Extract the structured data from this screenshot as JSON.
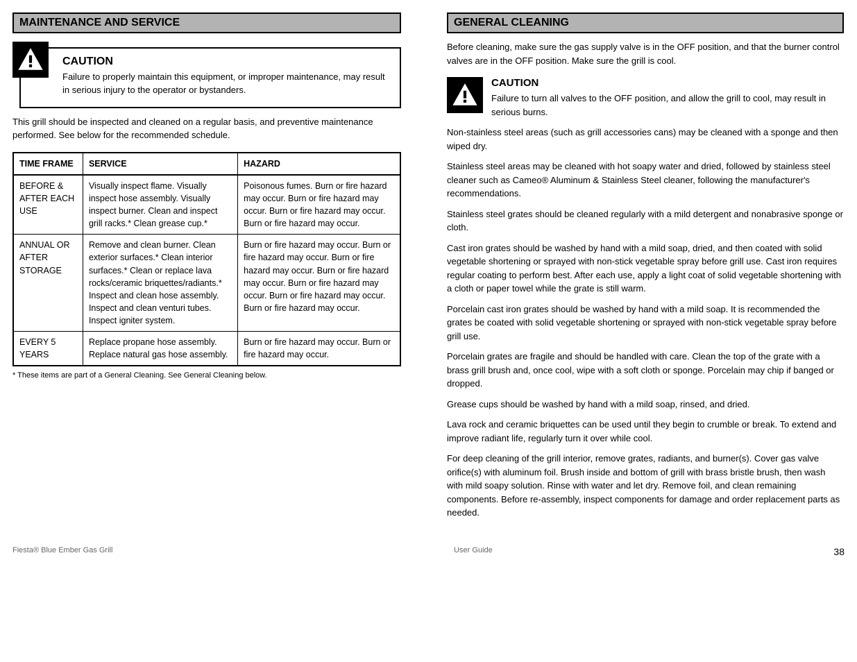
{
  "left": {
    "header": "MAINTENANCE AND SERVICE",
    "caution": {
      "title": "CAUTION",
      "text": "Failure to properly maintain this equipment, or improper maintenance, may result in serious injury to the operator or bystanders."
    },
    "intro": "This grill should be inspected and cleaned on a regular basis, and preventive maintenance performed. See below for the recommended schedule.",
    "table": {
      "headers": [
        "TIME FRAME",
        "SERVICE",
        "HAZARD"
      ],
      "rows": [
        {
          "time": "BEFORE & AFTER EACH USE",
          "service": "Visually inspect flame. Visually inspect hose assembly. Visually inspect burner. Clean and inspect grill racks.* Clean grease cup.*",
          "hazard": "Poisonous fumes. Burn or fire hazard may occur. Burn or fire hazard may occur. Burn or fire hazard may occur. Burn or fire hazard may occur."
        },
        {
          "time": "ANNUAL OR AFTER STORAGE",
          "service": "Remove and clean burner. Clean exterior surfaces.* Clean interior surfaces.* Clean or replace lava rocks/ceramic briquettes/radiants.* Inspect and clean hose assembly. Inspect and clean venturi tubes. Inspect igniter system.",
          "hazard": "Burn or fire hazard may occur. Burn or fire hazard may occur. Burn or fire hazard may occur. Burn or fire hazard may occur. Burn or fire hazard may occur. Burn or fire hazard may occur. Burn or fire hazard may occur."
        },
        {
          "time": "EVERY 5 YEARS",
          "service": "Replace propane hose assembly. Replace natural gas hose assembly.",
          "hazard": "Burn or fire hazard may occur. Burn or fire hazard may occur."
        }
      ]
    },
    "footnote": "* These items are part of a General Cleaning. See General Cleaning below."
  },
  "right": {
    "header": "GENERAL CLEANING",
    "intro": "Before cleaning, make sure the gas supply valve is in the OFF position, and that the burner control valves are in the OFF position. Make sure the grill is cool.",
    "caution": {
      "title": "CAUTION",
      "text": "Failure to turn all valves to the OFF position, and allow the grill to cool, may result in serious burns."
    },
    "paragraphs": [
      "Non-stainless steel areas (such as grill accessories cans) may be cleaned with a sponge and then wiped dry.",
      "Stainless steel areas may be cleaned with hot soapy water and dried, followed by stainless steel cleaner such as Cameo® Aluminum & Stainless Steel cleaner, following the manufacturer's recommendations.",
      "Stainless steel grates should be cleaned regularly with a mild detergent and nonabrasive sponge or cloth.",
      "Cast iron grates should be washed by hand with a mild soap, dried, and then coated with solid vegetable shortening or sprayed with non-stick vegetable spray before grill use. Cast iron requires regular coating to perform best. After each use, apply a light coat of solid vegetable shortening with a cloth or paper towel while the grate is still warm.",
      "Porcelain cast iron grates should be washed by hand with a mild soap. It is recommended the grates be coated with solid vegetable shortening or sprayed with non-stick vegetable spray before grill use.",
      "Porcelain grates are fragile and should be handled with care. Clean the top of the grate with a brass grill brush and, once cool, wipe with a soft cloth or sponge. Porcelain may chip if banged or dropped.",
      "Grease cups should be washed by hand with a mild soap, rinsed, and dried.",
      "Lava rock and ceramic briquettes can be used until they begin to crumble or break. To extend and improve radiant life, regularly turn it over while cool.",
      "For deep cleaning of the grill interior, remove grates, radiants, and burner(s). Cover gas valve orifice(s) with aluminum foil. Brush inside and bottom of grill with brass bristle brush, then wash with mild soapy solution. Rinse with water and let dry. Remove foil, and clean remaining components. Before re-assembly, inspect components for damage and order replacement parts as needed."
    ]
  },
  "footer": {
    "left": "Fiesta® Blue Ember Gas Grill",
    "center": "User Guide",
    "right": "38"
  }
}
